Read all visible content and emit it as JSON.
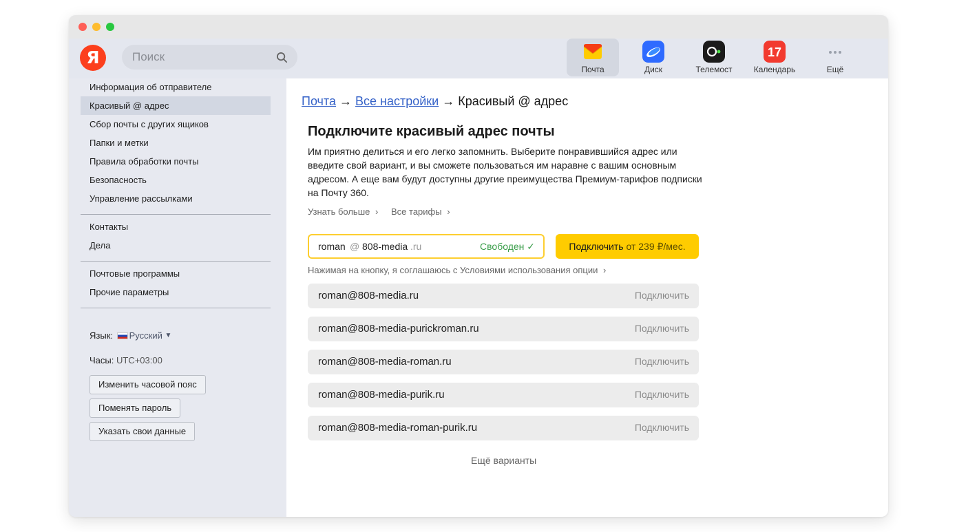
{
  "header": {
    "logo_letter": "Я",
    "search_placeholder": "Поиск",
    "services": [
      {
        "label": "Почта",
        "icon": "mail-envelope-icon",
        "color": "#ffcc00"
      },
      {
        "label": "Диск",
        "icon": "cloud-disk-icon",
        "color": "#2f6bff"
      },
      {
        "label": "Телемост",
        "icon": "telemost-camera-icon",
        "color": "#111111"
      },
      {
        "label": "Календарь",
        "icon": "calendar-icon",
        "color": "#f23a2f",
        "day": "17"
      },
      {
        "label": "Ещё",
        "icon": "more-dots-icon",
        "color": "#9aa0ab"
      }
    ]
  },
  "sidebar": {
    "items": [
      {
        "label": "Информация об отправителе"
      },
      {
        "label": "Красивый @ адрес"
      },
      {
        "label": "Сбор почты с других ящиков"
      },
      {
        "label": "Папки и метки"
      },
      {
        "label": "Правила обработки почты"
      },
      {
        "label": "Безопасность"
      },
      {
        "label": "Управление рассылками"
      },
      {
        "label": "Контакты"
      },
      {
        "label": "Дела"
      },
      {
        "label": "Почтовые программы"
      },
      {
        "label": "Прочие параметры"
      }
    ],
    "language_label": "Язык:",
    "language_value": "Русский",
    "clock_label": "Часы:",
    "clock_value": "UTC+03:00",
    "buttons": {
      "change_timezone": "Изменить часовой пояс",
      "change_password": "Поменять пароль",
      "specify_data": "Указать свои данные"
    }
  },
  "main": {
    "breadcrumb": {
      "mail": "Почта",
      "all_settings": "Все настройки",
      "current": "Красивый @ адрес",
      "arrow": "→"
    },
    "title": "Подключите красивый адрес почты",
    "description": "Им приятно делиться и его легко запомнить. Выберите понравившийся адрес или введите свой вариант, и вы сможете пользоваться им наравне с вашим основным адресом. А еще вам будут доступны другие преимущества Премиум-тарифов подписки на Почту 360.",
    "learn_more": "Узнать больше",
    "all_tariffs": "Все тарифы",
    "address_input": {
      "login": "roman",
      "at": "@",
      "domain": "808-media",
      "tld": ".ru",
      "status": "Свободен ✓"
    },
    "connect_button": {
      "label": "Подключить",
      "price": "от 239 ₽/мес."
    },
    "terms": "Нажимая на кнопку, я соглашаюсь с Условиями использования опции",
    "options": [
      {
        "address": "roman@808-media.ru",
        "action": "Подключить"
      },
      {
        "address": "roman@808-media-purickroman.ru",
        "action": "Подключить"
      },
      {
        "address": "roman@808-media-roman.ru",
        "action": "Подключить"
      },
      {
        "address": "roman@808-media-purik.ru",
        "action": "Подключить"
      },
      {
        "address": "roman@808-media-roman-purik.ru",
        "action": "Подключить"
      }
    ],
    "more_variants": "Ещё варианты"
  }
}
